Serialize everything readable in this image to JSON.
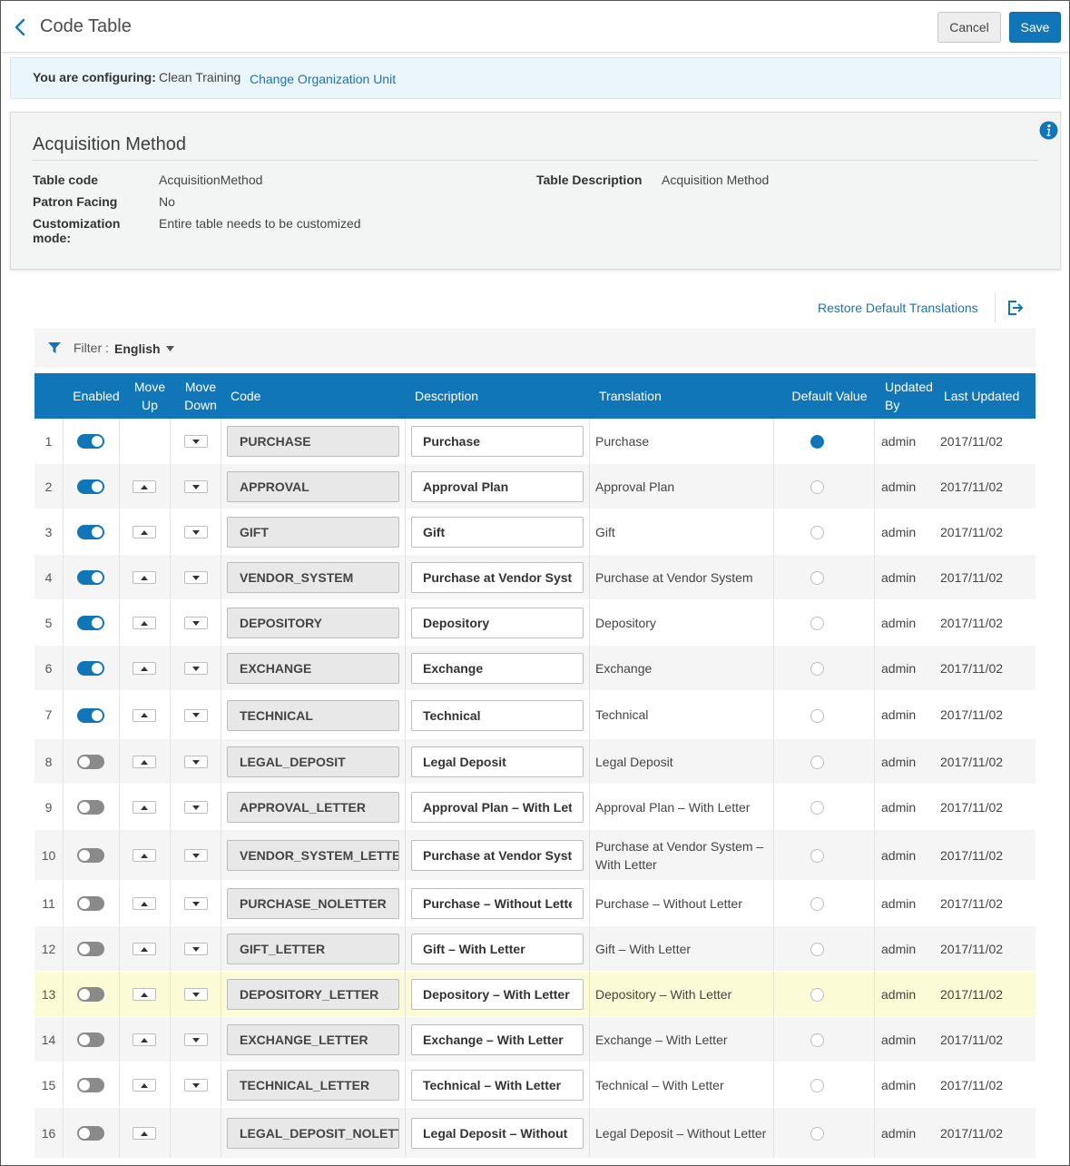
{
  "header": {
    "title": "Code Table",
    "cancel_label": "Cancel",
    "save_label": "Save"
  },
  "config": {
    "label": "You are configuring:",
    "value": "Clean Training",
    "link": "Change Organization Unit"
  },
  "details": {
    "title": "Acquisition Method",
    "fields": {
      "table_code_label": "Table code",
      "table_code_value": "AcquisitionMethod",
      "patron_facing_label": "Patron Facing",
      "patron_facing_value": "No",
      "customization_mode_label": "Customization mode:",
      "customization_mode_value": "Entire table needs to be customized",
      "table_description_label": "Table Description",
      "table_description_value": "Acquisition Method"
    }
  },
  "toolbar": {
    "restore_label": "Restore Default Translations",
    "filter_label": "Filter :",
    "filter_value": "English"
  },
  "colors": {
    "accent": "#1176b8",
    "highlight_row": "#fbfbd6",
    "info_bar": "#eaf6fb"
  },
  "table": {
    "columns": [
      "Enabled",
      "Move Up",
      "Move Down",
      "Code",
      "Description",
      "Translation",
      "Default Value",
      "Updated By",
      "Last Updated"
    ],
    "rows": [
      {
        "num": "1",
        "enabled": true,
        "code": "PURCHASE",
        "description": "Purchase",
        "translation": "Purchase",
        "default": true,
        "updated_by": "admin",
        "last_updated": "2017/11/02"
      },
      {
        "num": "2",
        "enabled": true,
        "code": "APPROVAL",
        "description": "Approval Plan",
        "translation": "Approval Plan",
        "default": false,
        "updated_by": "admin",
        "last_updated": "2017/11/02"
      },
      {
        "num": "3",
        "enabled": true,
        "code": "GIFT",
        "description": "Gift",
        "translation": "Gift",
        "default": false,
        "updated_by": "admin",
        "last_updated": "2017/11/02"
      },
      {
        "num": "4",
        "enabled": true,
        "code": "VENDOR_SYSTEM",
        "description": "Purchase at Vendor System",
        "translation": "Purchase at Vendor System",
        "default": false,
        "updated_by": "admin",
        "last_updated": "2017/11/02"
      },
      {
        "num": "5",
        "enabled": true,
        "code": "DEPOSITORY",
        "description": "Depository",
        "translation": "Depository",
        "default": false,
        "updated_by": "admin",
        "last_updated": "2017/11/02"
      },
      {
        "num": "6",
        "enabled": true,
        "code": "EXCHANGE",
        "description": "Exchange",
        "translation": "Exchange",
        "default": false,
        "updated_by": "admin",
        "last_updated": "2017/11/02"
      },
      {
        "num": "7",
        "enabled": true,
        "code": "TECHNICAL",
        "description": "Technical",
        "translation": "Technical",
        "default": false,
        "updated_by": "admin",
        "last_updated": "2017/11/02"
      },
      {
        "num": "8",
        "enabled": false,
        "code": "LEGAL_DEPOSIT",
        "description": "Legal Deposit",
        "translation": "Legal Deposit",
        "default": false,
        "updated_by": "admin",
        "last_updated": "2017/11/02"
      },
      {
        "num": "9",
        "enabled": false,
        "code": "APPROVAL_LETTER",
        "description": "Approval Plan – With Letter",
        "translation": "Approval Plan – With Letter",
        "default": false,
        "updated_by": "admin",
        "last_updated": "2017/11/02"
      },
      {
        "num": "10",
        "enabled": false,
        "code": "VENDOR_SYSTEM_LETTER",
        "description": "Purchase at Vendor System – With Letter",
        "translation": "Purchase at Vendor System – With Letter",
        "default": false,
        "updated_by": "admin",
        "last_updated": "2017/11/02"
      },
      {
        "num": "11",
        "enabled": false,
        "code": "PURCHASE_NOLETTER",
        "description": "Purchase – Without Letter",
        "translation": "Purchase – Without Letter",
        "default": false,
        "updated_by": "admin",
        "last_updated": "2017/11/02"
      },
      {
        "num": "12",
        "enabled": false,
        "code": "GIFT_LETTER",
        "description": "Gift – With Letter",
        "translation": "Gift – With Letter",
        "default": false,
        "updated_by": "admin",
        "last_updated": "2017/11/02"
      },
      {
        "num": "13",
        "enabled": false,
        "code": "DEPOSITORY_LETTER",
        "description": "Depository – With Letter",
        "translation": "Depository – With Letter",
        "default": false,
        "updated_by": "admin",
        "last_updated": "2017/11/02"
      },
      {
        "num": "14",
        "enabled": false,
        "code": "EXCHANGE_LETTER",
        "description": "Exchange – With Letter",
        "translation": "Exchange – With Letter",
        "default": false,
        "updated_by": "admin",
        "last_updated": "2017/11/02"
      },
      {
        "num": "15",
        "enabled": false,
        "code": "TECHNICAL_LETTER",
        "description": "Technical – With Letter",
        "translation": "Technical – With Letter",
        "default": false,
        "updated_by": "admin",
        "last_updated": "2017/11/02"
      },
      {
        "num": "16",
        "enabled": false,
        "code": "LEGAL_DEPOSIT_NOLETTER",
        "description": "Legal Deposit – Without Letter",
        "translation": "Legal Deposit – Without Letter",
        "default": false,
        "updated_by": "admin",
        "last_updated": "2017/11/02"
      }
    ]
  }
}
